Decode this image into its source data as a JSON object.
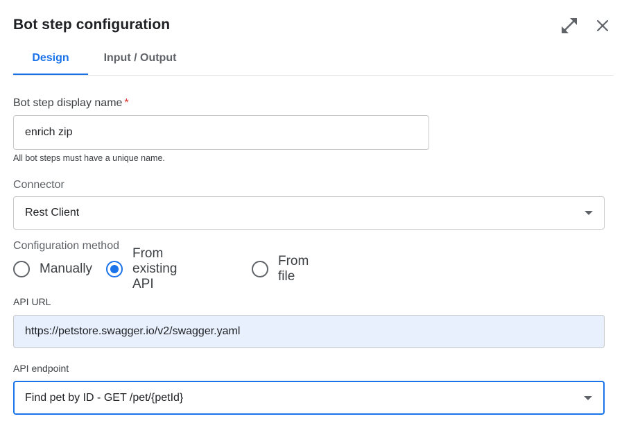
{
  "dialog": {
    "title": "Bot step configuration",
    "expand_icon": "expand-icon",
    "close_icon": "close-icon"
  },
  "tabs": [
    {
      "label": "Design",
      "active": true
    },
    {
      "label": "Input / Output",
      "active": false
    }
  ],
  "display_name": {
    "label": "Bot step display name",
    "required_mark": "*",
    "value": "enrich zip",
    "hint": "All bot steps must have a unique name."
  },
  "connector": {
    "label": "Connector",
    "value": "Rest Client"
  },
  "config_method": {
    "label": "Configuration method",
    "options": [
      {
        "label": "Manually",
        "checked": false
      },
      {
        "label": "From existing API",
        "checked": true
      },
      {
        "label": "From file",
        "checked": false
      }
    ]
  },
  "api_url": {
    "label": "API URL",
    "value": "https://petstore.swagger.io/v2/swagger.yaml"
  },
  "api_endpoint": {
    "label": "API endpoint",
    "value": "Find pet by ID - GET /pet/{petId}"
  },
  "colors": {
    "accent": "#1a73e8",
    "required": "#d93025",
    "filled_bg": "#e8f0fe"
  }
}
